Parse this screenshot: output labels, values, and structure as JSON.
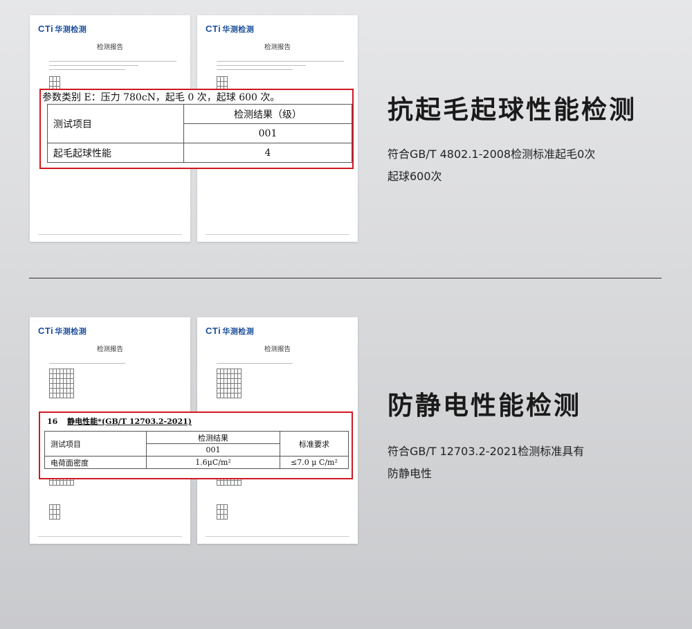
{
  "logo": {
    "brand": "CTi",
    "cn": "华测检测"
  },
  "doc_title": "检测报告",
  "sections": [
    {
      "heading": "抗起毛起球性能检测",
      "desc_line1": "符合GB/T 4802.1-2008检测标准起毛0次",
      "desc_line2": "起球600次",
      "zoom": {
        "caption": "参数类别 E：压力 780cN，起毛 0 次，起球 600 次。",
        "col_item": "测试项目",
        "col_result": "检测结果（级）",
        "sample": "001",
        "row_label": "起毛起球性能",
        "row_value": "4"
      }
    },
    {
      "heading": "防静电性能检测",
      "desc_line1": "符合GB/T 12703.2-2021检测标准具有",
      "desc_line2": "防静电性",
      "zoom": {
        "no": "16",
        "title": "静电性能*(GB/T 12703.2-2021)",
        "col_item": "测试项目",
        "col_result": "检测结果",
        "col_req": "标准要求",
        "sample": "001",
        "row_label": "电荷面密度",
        "row_value": "1.6μC/m²",
        "row_req": "≤7.0 μ C/m²"
      }
    }
  ]
}
